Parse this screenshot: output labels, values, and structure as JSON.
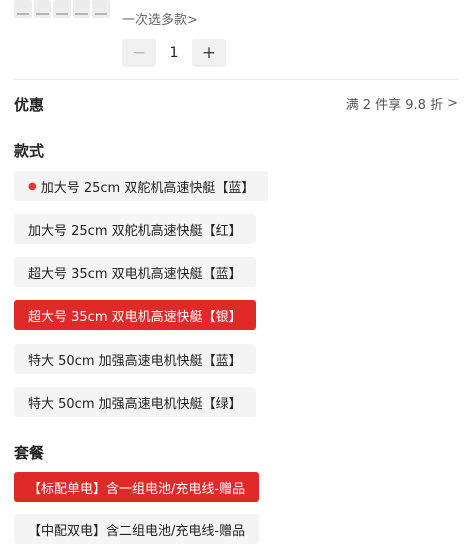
{
  "header": {
    "multi_select_text": "一次选多款",
    "quantity": "1",
    "minus_label": "−",
    "plus_label": "+"
  },
  "promotion": {
    "label": "优惠",
    "offer_text": "满 2 件享 9.8 折"
  },
  "style_section": {
    "label": "款式",
    "options": [
      {
        "label": "加大号 25cm 双舵机高速快艇【蓝】",
        "selected": false,
        "hot": true
      },
      {
        "label": "加大号 25cm 双舵机高速快艇【红】",
        "selected": false,
        "hot": false
      },
      {
        "label": "超大号 35cm 双电机高速快艇【蓝】",
        "selected": false,
        "hot": false
      },
      {
        "label": "超大号 35cm 双电机高速快艇【银】",
        "selected": true,
        "hot": false
      },
      {
        "label": "特大 50cm 加强高速电机快艇【蓝】",
        "selected": false,
        "hot": false
      },
      {
        "label": "特大 50cm 加强高速电机快艇【绿】",
        "selected": false,
        "hot": false
      }
    ]
  },
  "package_section": {
    "label": "套餐",
    "options": [
      {
        "label": "【标配单电】含一组电池/充电线-赠品",
        "selected": true
      },
      {
        "label": "【中配双电】含二组电池/充电线-赠品",
        "selected": false
      }
    ]
  },
  "colors": {
    "accent": "#e02a2a",
    "chip_bg": "#f4f4f4"
  }
}
